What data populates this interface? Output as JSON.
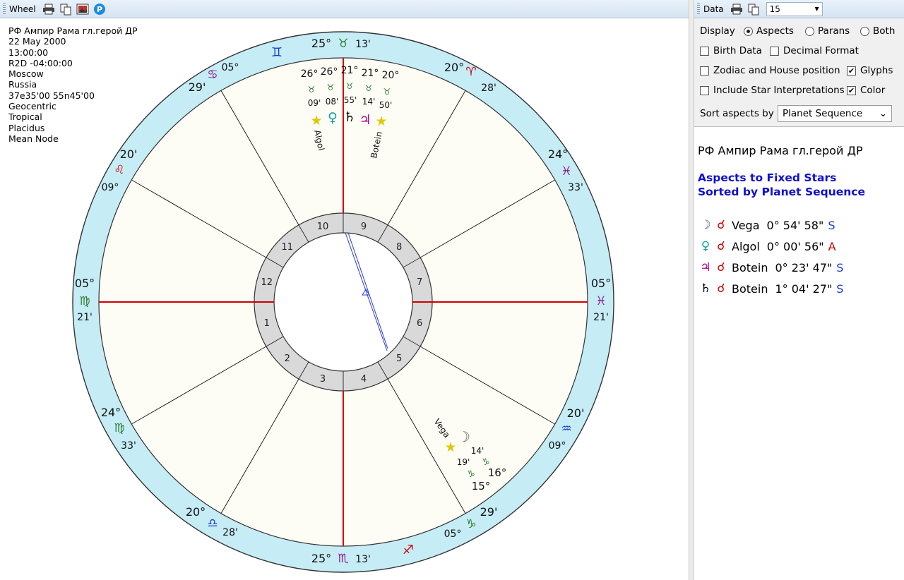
{
  "wheel_toolbar": {
    "label": "Wheel"
  },
  "chart_info": [
    "РФ Ампир Рама гл.герой ДР",
    "22 May 2000",
    "13:00:00",
    "R2D -04:00:00",
    "Moscow",
    "Russia",
    "37e35'00 55n45'00",
    "Geocentric",
    "Tropical",
    "Placidus",
    "Mean Node"
  ],
  "wheel": {
    "cusp_labels": [
      {
        "deg": "25°",
        "sign": "♉",
        "min": "13'",
        "sign_color": "#2e7d32"
      },
      {
        "deg": "20°",
        "sign": "♈",
        "min": "28'",
        "sign_color": "#d00000"
      },
      {
        "deg": "24°",
        "sign": "♓",
        "min": "33'",
        "sign_color": "#8a148a"
      },
      {
        "deg": "05°",
        "sign": "♓",
        "min": "21'",
        "sign_color": "#8a148a"
      },
      {
        "deg": "20'",
        "sign": "♒",
        "min": "09°",
        "sign_color": "#1a3cd0"
      },
      {
        "deg": "29'",
        "sign": "♑",
        "min": "05°",
        "sign_color": "#2e7d32"
      },
      {
        "deg": "25°",
        "sign": "♏",
        "min": "13'",
        "sign_color": "#8a148a"
      },
      {
        "deg": "20°",
        "sign": "♎",
        "min": "28'",
        "sign_color": "#1a3cd0"
      },
      {
        "deg": "24°",
        "sign": "♍",
        "min": "33'",
        "sign_color": "#2e7d32"
      },
      {
        "deg": "05°",
        "sign": "♍",
        "min": "21'",
        "sign_color": "#2e7d32"
      },
      {
        "deg": "20'",
        "sign": "♌",
        "min": "09°",
        "sign_color": "#d00000"
      },
      {
        "deg": "29'",
        "sign": "♋",
        "min": "05°",
        "sign_color": "#8a148a"
      }
    ],
    "ring_signs": [
      {
        "glyph": "♊",
        "color": "#1a3cd0"
      },
      {
        "glyph": "♐",
        "color": "#d00000"
      }
    ],
    "house_numbers": [
      "1",
      "2",
      "3",
      "4",
      "5",
      "6",
      "7",
      "8",
      "9",
      "10",
      "11",
      "12"
    ],
    "top_planets": {
      "degrees": [
        "26°",
        "26°",
        "21°",
        "21°",
        "20°"
      ],
      "signs": [
        "♉",
        "♉",
        "♉",
        "♉",
        "♉"
      ],
      "minutes": [
        "09'",
        "08'",
        "55'",
        "14'",
        "50'"
      ],
      "glyphs": [
        {
          "g": "★",
          "color": "#e0c800"
        },
        {
          "g": "♀",
          "color": "#14a0a0"
        },
        {
          "g": "♄",
          "color": "#000000"
        },
        {
          "g": "♃",
          "color": "#b0008c"
        },
        {
          "g": "★",
          "color": "#e0c800"
        }
      ],
      "star_names": [
        "Algol",
        "Botein"
      ]
    },
    "bottom_planets": {
      "star_name": "Vega",
      "star_glyph": "★",
      "moon_glyph": "☽",
      "min_a": "14'",
      "min_b": "19'",
      "sign_glyph": "♑",
      "deg_a": "16°",
      "deg_b": "15°"
    }
  },
  "data_toolbar": {
    "label": "Data",
    "combo_value": "15"
  },
  "options": {
    "display_label": "Display",
    "radio_aspects": "Aspects",
    "radio_parans": "Parans",
    "radio_both": "Both",
    "birth_data": "Birth Data",
    "decimal_format": "Decimal Format",
    "zodiac_house": "Zodiac and House position",
    "glyphs": "Glyphs",
    "include_interp": "Include Star Interpretations",
    "color": "Color",
    "sort_label": "Sort aspects by",
    "sort_value": "Planet Sequence"
  },
  "report": {
    "title": "РФ Ампир Рама гл.герой ДР",
    "heading1": "Aspects to Fixed Stars",
    "heading2": "Sorted by Planet Sequence",
    "rows": [
      {
        "planet": "☽",
        "pcolor": "#555555",
        "aspect": "☌",
        "star": "Vega",
        "deg": "0° 54' 58\"",
        "cls": "S",
        "ccolor": "#1a3cd0"
      },
      {
        "planet": "♀",
        "pcolor": "#14a0a0",
        "aspect": "☌",
        "star": "Algol",
        "deg": "0° 00' 56\"",
        "cls": "A",
        "ccolor": "#d00000"
      },
      {
        "planet": "♃",
        "pcolor": "#b0008c",
        "aspect": "☌",
        "star": "Botein",
        "deg": "0° 23' 47\"",
        "cls": "S",
        "ccolor": "#1a3cd0"
      },
      {
        "planet": "♄",
        "pcolor": "#000000",
        "aspect": "☌",
        "star": "Botein",
        "deg": "1° 04' 27\"",
        "cls": "S",
        "ccolor": "#1a3cd0"
      }
    ]
  }
}
